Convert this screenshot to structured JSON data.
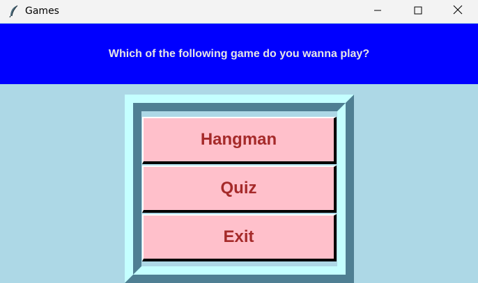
{
  "window": {
    "title": "Games",
    "app_icon": "feather-icon",
    "controls": [
      "minimize-icon",
      "maximize-icon",
      "close-icon"
    ]
  },
  "header": {
    "question": "Which of the following game do you wanna play?"
  },
  "menu": {
    "buttons": [
      {
        "label": "Hangman"
      },
      {
        "label": "Quiz"
      },
      {
        "label": "Exit"
      }
    ]
  },
  "colors": {
    "background": "#add8e6",
    "header_bg": "#0000ff",
    "header_text": "#e6e6e6",
    "button_bg": "#ffc0cb",
    "button_text": "#a52a2a",
    "frame_light": "#c4ffff",
    "frame_dark": "#4f7f93"
  }
}
